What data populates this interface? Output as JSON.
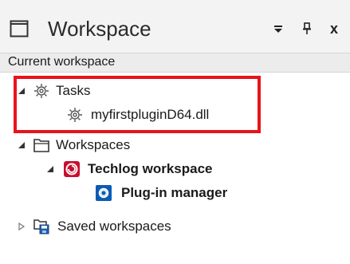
{
  "panel": {
    "title": "Workspace",
    "subheader": "Current workspace",
    "controls": {
      "dropdown_icon": "dropdown-arrow-icon",
      "pin_icon": "pin-icon",
      "close_icon": "close-icon",
      "close_glyph": "x"
    }
  },
  "tree": {
    "tasks": {
      "label": "Tasks",
      "icon": "gear-icon",
      "expanded": true,
      "children": [
        {
          "label": "myfirstpluginD64.dll",
          "icon": "gear-icon"
        }
      ]
    },
    "workspaces": {
      "label": "Workspaces",
      "icon": "folder-icon",
      "expanded": true,
      "children": [
        {
          "label": "Techlog workspace",
          "icon": "techlog-icon",
          "expanded": true,
          "children": [
            {
              "label": "Plug-in manager",
              "icon": "plugin-manager-icon"
            }
          ]
        }
      ]
    },
    "saved_workspaces": {
      "label": "Saved workspaces",
      "icon": "saved-folder-icon",
      "expanded": false
    }
  },
  "colors": {
    "highlight": "#e8141b",
    "accent": "#0a5bb5",
    "techlog": "#c8102e"
  }
}
